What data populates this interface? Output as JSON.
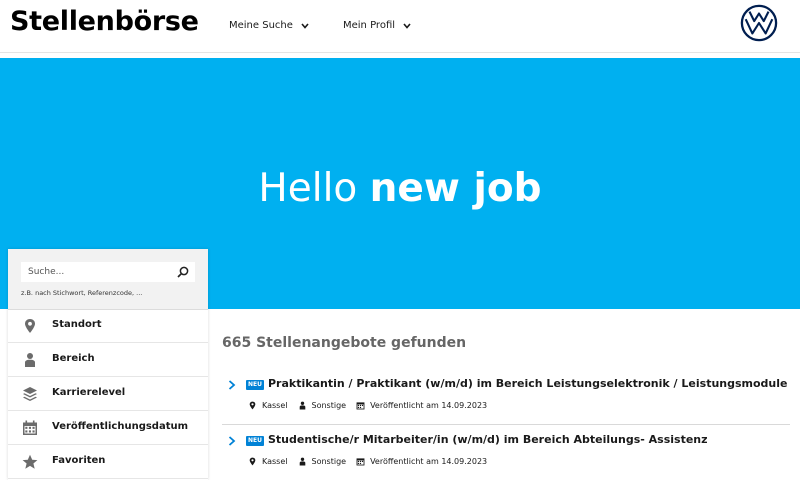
{
  "header": {
    "brand": "Stellenbörse",
    "nav": [
      {
        "label": "Meine Suche"
      },
      {
        "label": "Mein Profil"
      }
    ],
    "logo_icon": "vw-logo-icon"
  },
  "hero": {
    "title_light": "Hello ",
    "title_bold": "new job",
    "background": "#00b0f0"
  },
  "search": {
    "placeholder": "Suche...",
    "hint": "z.B. nach Stichwort, Referenzcode, ..."
  },
  "filters": [
    {
      "label": "Standort",
      "icon": "map-pin-icon"
    },
    {
      "label": "Bereich",
      "icon": "person-icon"
    },
    {
      "label": "Karrierelevel",
      "icon": "layers-icon"
    },
    {
      "label": "Veröffentlichungsdatum",
      "icon": "calendar-icon"
    },
    {
      "label": "Favoriten",
      "icon": "star-icon"
    }
  ],
  "results": {
    "count_text": "665 Stellenangebote gefunden",
    "jobs": [
      {
        "badge": "NEU",
        "title": "Praktikantin / Praktikant (w/m/d) im Bereich Leistungselektronik / Leistungsmodule",
        "location": "Kassel",
        "category": "Sonstige",
        "published": "Veröffentlicht am 14.09.2023"
      },
      {
        "badge": "NEU",
        "title": "Studentische/r Mitarbeiter/in (w/m/d) im Bereich Abteilungs- Assistenz",
        "location": "Kassel",
        "category": "Sonstige",
        "published": "Veröffentlicht am 14.09.2023"
      }
    ]
  },
  "colors": {
    "accent": "#00b0f0",
    "badge": "#0082d6",
    "logo": "#001e50",
    "icon": "#6b6b6b"
  }
}
